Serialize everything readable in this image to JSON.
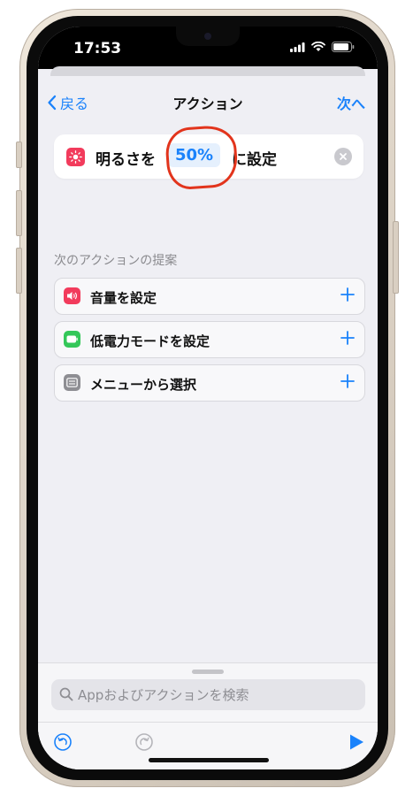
{
  "status_bar": {
    "time": "17:53"
  },
  "nav": {
    "back_label": "戻る",
    "title": "アクション",
    "next_label": "次へ"
  },
  "action": {
    "prefix": "明るさを",
    "value": "50%",
    "suffix": "に設定"
  },
  "suggestions": {
    "header": "次のアクションの提案",
    "items": [
      {
        "label": "音量を設定",
        "icon": "speaker-icon",
        "color": "#f23b5c"
      },
      {
        "label": "低電力モードを設定",
        "icon": "battery-icon",
        "color": "#34c759"
      },
      {
        "label": "メニューから選択",
        "icon": "menu-icon",
        "color": "#8e8e93"
      }
    ]
  },
  "search": {
    "placeholder": "Appおよびアクションを検索"
  },
  "colors": {
    "accent": "#1a82fb",
    "highlight": "#e2341c",
    "sheet_bg": "#efeff4"
  }
}
